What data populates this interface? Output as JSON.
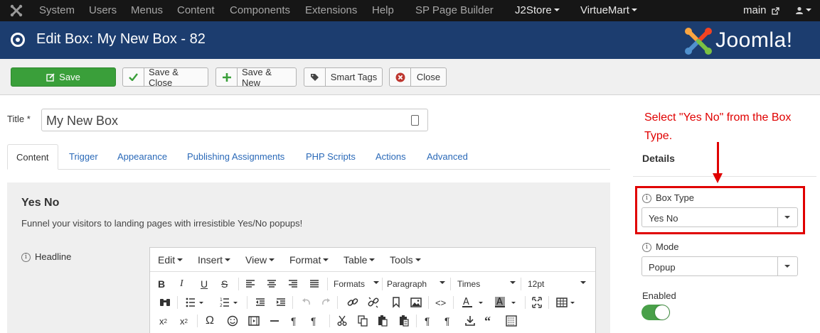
{
  "topmenu": {
    "items": [
      "System",
      "Users",
      "Menus",
      "Content",
      "Components",
      "Extensions",
      "Help"
    ],
    "sp_page_builder": "SP Page Builder",
    "j2store": "J2Store",
    "virtuemart": "VirtueMart",
    "main": "main",
    "external_link_icon": "external-link-icon",
    "user_icon": "user-icon"
  },
  "header": {
    "title": "Edit Box: My New Box - 82",
    "brand": "Joomla!",
    "colors": {
      "topbar": "#161616",
      "titlebar": "#1c3d6f"
    }
  },
  "toolbar": {
    "save": "Save",
    "save_close": "Save & Close",
    "save_new": "Save & New",
    "smart_tags": "Smart Tags",
    "close": "Close",
    "colors": {
      "save": "#3a9f3a",
      "check": "#3a9f3a",
      "close": "#bd362f"
    }
  },
  "form": {
    "title_label": "Title *",
    "title_value": "My New Box"
  },
  "tabs": [
    "Content",
    "Trigger",
    "Appearance",
    "Publishing Assignments",
    "PHP Scripts",
    "Actions",
    "Advanced"
  ],
  "content": {
    "heading": "Yes No",
    "description": "Funnel your visitors to landing pages with irresistible Yes/No popups!",
    "headline_label": "Headline"
  },
  "editor": {
    "menu": [
      "Edit",
      "Insert",
      "View",
      "Format",
      "Table",
      "Tools"
    ],
    "formats": "Formats",
    "block": "Paragraph",
    "font": "Times",
    "size": "12pt"
  },
  "sidebar": {
    "annotation": "Select \"Yes No\" from the Box Type.",
    "details": "Details",
    "box_type_label": "Box Type",
    "box_type_value": "Yes No",
    "mode_label": "Mode",
    "mode_value": "Popup",
    "enabled_label": "Enabled",
    "enabled": true,
    "colors": {
      "annotation": "#e00000",
      "toggle_on": "#49a049"
    }
  }
}
